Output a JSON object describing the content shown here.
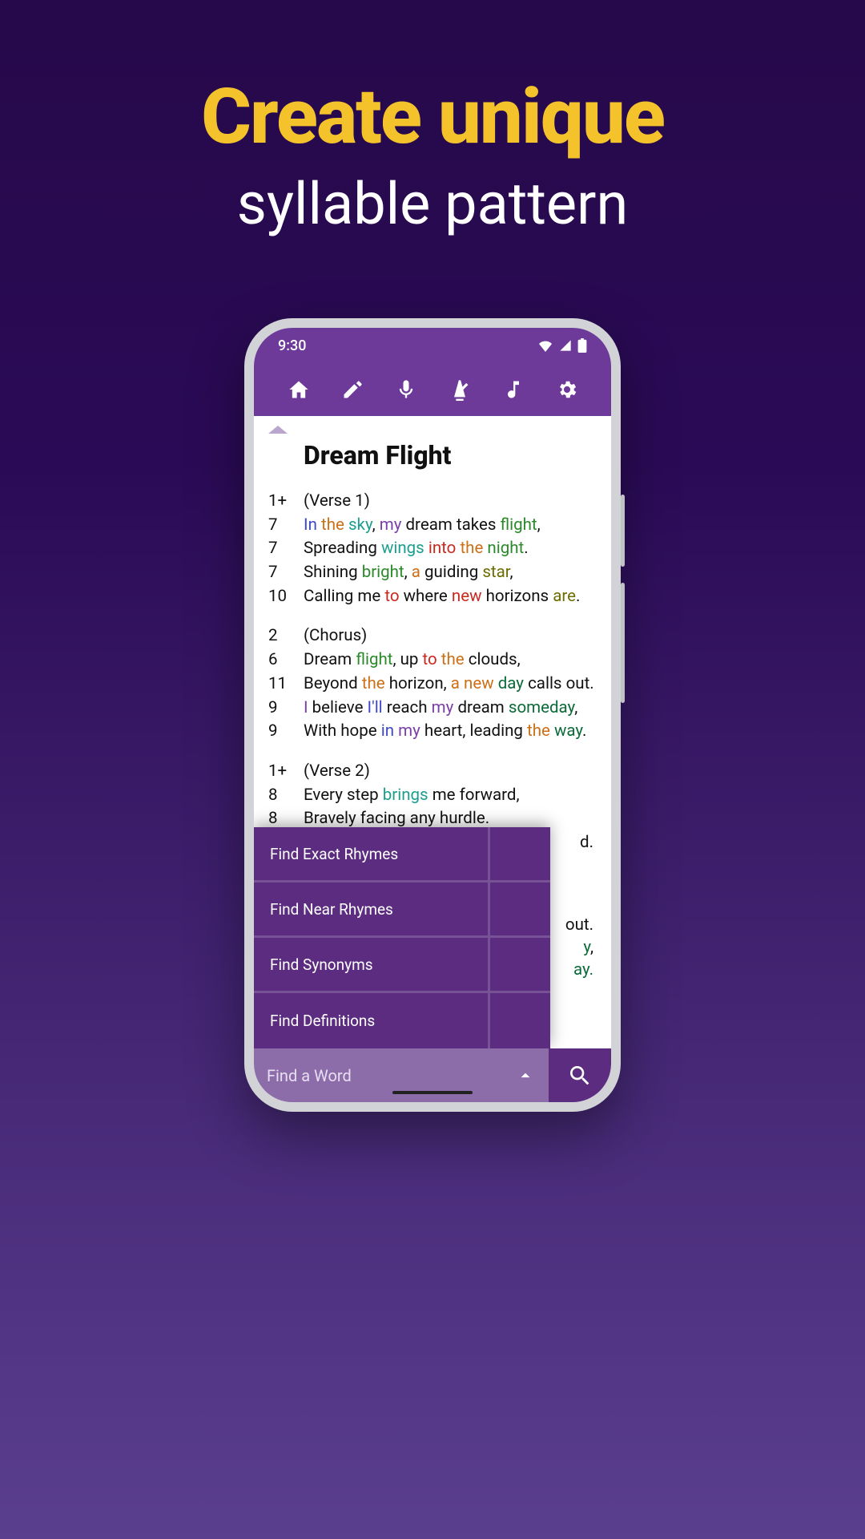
{
  "headline": {
    "top": "Create unique",
    "bottom": "syllable pattern"
  },
  "status": {
    "time": "9:30"
  },
  "song": {
    "title": "Dream Flight"
  },
  "lines": {
    "v1_label": "(Verse 1)",
    "v1_count": "1+",
    "l1_count": "7",
    "l2_count": "7",
    "l3_count": "7",
    "l4_count": "10",
    "ch_label": "(Chorus)",
    "ch_count": "2",
    "c1_count": "6",
    "c2_count": "11",
    "c3_count": "9",
    "c4_count": "9",
    "v2_label": "(Verse 2)",
    "v2_count": "1+",
    "b1_count": "8",
    "b2_count": "8"
  },
  "words": {
    "In": "In",
    "the": "the",
    "sky": "sky",
    "my": "my",
    "dream_takes": "dream takes",
    "flight": "flight",
    "comma": ",",
    "Spreading": "Spreading",
    "wings": "wings",
    "into": "into",
    "night": "night",
    "period": ".",
    "Shining": "Shining",
    "bright": "bright",
    "a": "a",
    "guiding": "guiding",
    "star": "star",
    "Calling_me": "Calling me",
    "to": "to",
    "where": "where",
    "new": "new",
    "horizons": "horizons",
    "are": "are",
    "Dream": "Dream",
    "up": "up",
    "clouds": "clouds",
    "Beyond": "Beyond",
    "horizon": "horizon",
    "a_new": "a new",
    "day": "day",
    "calls_out": "calls out",
    "I": "I",
    "believe": "believe",
    "Ill": "I'll",
    "reach": "reach",
    "someday": "someday",
    "With_hope": "With hope",
    "in": "in",
    "heart": "heart",
    "leading": "leading",
    "way": "way",
    "Every_step": "Every step",
    "brings": "brings",
    "me_forward": "me forward,",
    "Bravely": "Bravely facing any hurdle."
  },
  "overflow": {
    "o1": "d.",
    "o2": "out.",
    "o3": ",",
    "o4": "ay."
  },
  "popup": {
    "items": [
      "Find Exact Rhymes",
      "Find Near Rhymes",
      "Find Synonyms",
      "Find Definitions"
    ]
  },
  "search": {
    "placeholder": "Find a Word"
  }
}
